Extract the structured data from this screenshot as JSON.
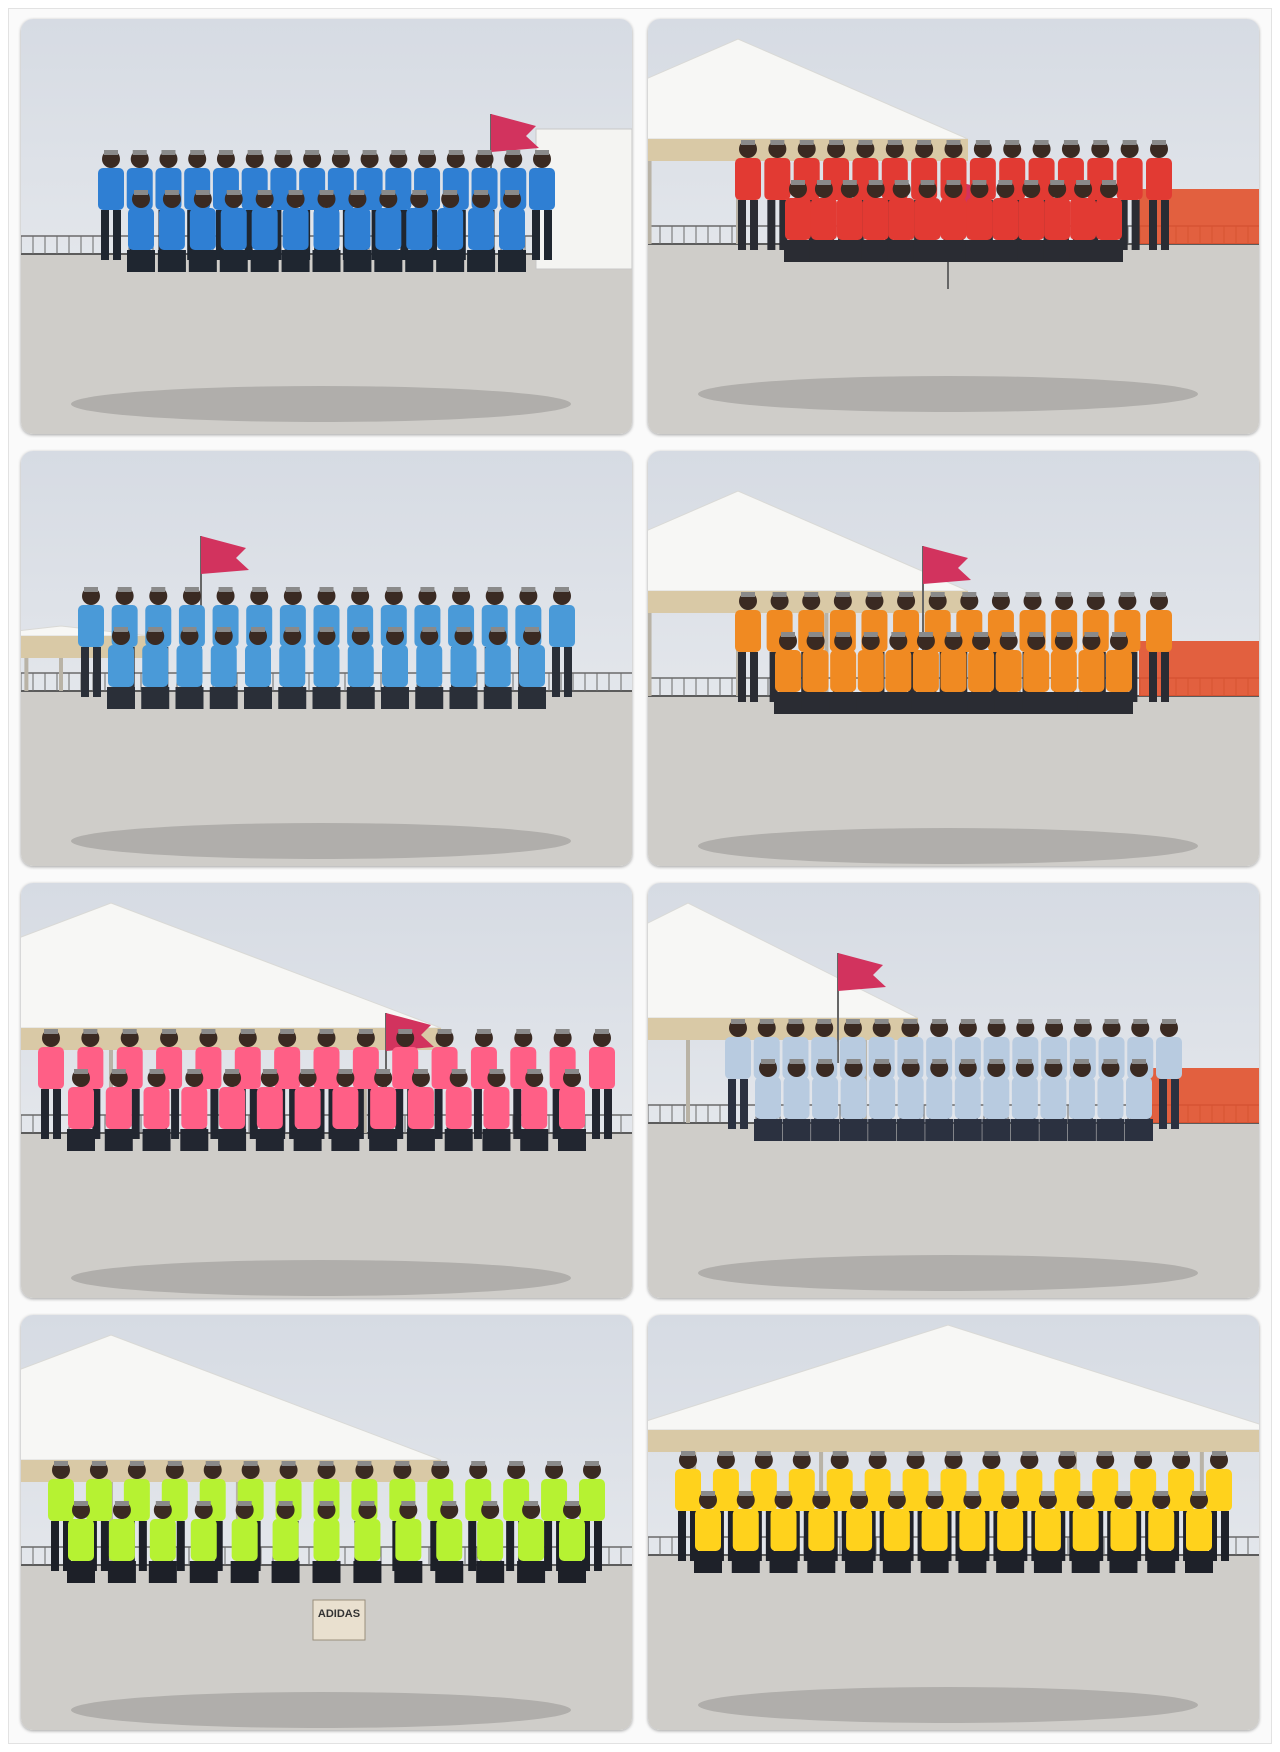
{
  "collage": {
    "background": "#ffffff",
    "sky_top": "#d6dbe3",
    "sky_bottom": "#eceef1",
    "ground": "#cfcdc9",
    "photos": [
      {
        "shirt_color": "#2f7fd3",
        "pants_color": "#1f2630",
        "scene": "blue-shirts-with-flag"
      },
      {
        "shirt_color": "#e23a33",
        "pants_color": "#2a2c33",
        "scene": "red-shirts-with-flag"
      },
      {
        "shirt_color": "#4a9ad8",
        "pants_color": "#2a2f38",
        "scene": "light-blue-shirts-with-flag"
      },
      {
        "shirt_color": "#f08a22",
        "pants_color": "#2a2c33",
        "scene": "orange-shirts-with-canopy"
      },
      {
        "shirt_color": "#ff5f86",
        "pants_color": "#222630",
        "scene": "pink-shirts-with-canopy"
      },
      {
        "shirt_color": "#b8cbe0",
        "pants_color": "#2b3140",
        "scene": "grey-shirts-with-flag"
      },
      {
        "shirt_color": "#b6f232",
        "pants_color": "#1d2028",
        "scene": "neon-green-shirts-with-canopy",
        "bag_text": "ADIDAS"
      },
      {
        "shirt_color": "#ffd21c",
        "pants_color": "#1e2129",
        "scene": "yellow-shirts-with-canopy"
      }
    ]
  }
}
